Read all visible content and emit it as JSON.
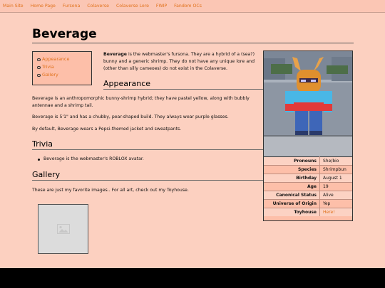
{
  "nav": {
    "items": [
      "Main Site",
      "Home Page",
      "Fursona",
      "Colaverse",
      "Colaverse Lore",
      "FWIP",
      "Fandom OCs"
    ]
  },
  "page": {
    "title": "Beverage"
  },
  "toc": {
    "items": [
      "Appearance",
      "Trivia",
      "Gallery"
    ]
  },
  "intro": {
    "name": "Beverage",
    "text": " is the webmaster's fursona. They are a hybrid of a (sea?) bunny and a generic shrimp. They do not have any unique lore and (other than silly cameoes) do not exist in the Colaverse."
  },
  "appearance": {
    "heading": "Appearance",
    "paragraphs": [
      "Beverage is an anthropomorphic bunny-shrimp hybrid; they have pastel yellow, along with bubbly antennae and a shrimp tail.",
      "Beverage is 5'1\" and has a chubby, pear-shaped build. They always wear purple glasses.",
      "By default, Beverage wears a Pepsi-themed jacket and sweatpants."
    ]
  },
  "trivia": {
    "heading": "Trivia",
    "items": [
      "Beverage is the webmaster's ROBLOX avatar."
    ]
  },
  "gallery": {
    "heading": "Gallery",
    "text": "These are just my favorite images.. For all art, check out my Toyhouse."
  },
  "infobox": {
    "rows": [
      {
        "key": "Pronouns",
        "value": "She/bio"
      },
      {
        "key": "Species",
        "value": "Shrimpbun"
      },
      {
        "key": "Birthday",
        "value": "August 1"
      },
      {
        "key": "Age",
        "value": "19"
      },
      {
        "key": "Canonical Status",
        "value": "Alive"
      },
      {
        "key": "Universe of Origin",
        "value": "Yep"
      },
      {
        "key": "Toyhouse",
        "value": "Here!"
      }
    ]
  },
  "colors": {
    "background": "#fcd0c0",
    "link": "#e0711a",
    "infobox_bg": "#fdbfa9"
  }
}
